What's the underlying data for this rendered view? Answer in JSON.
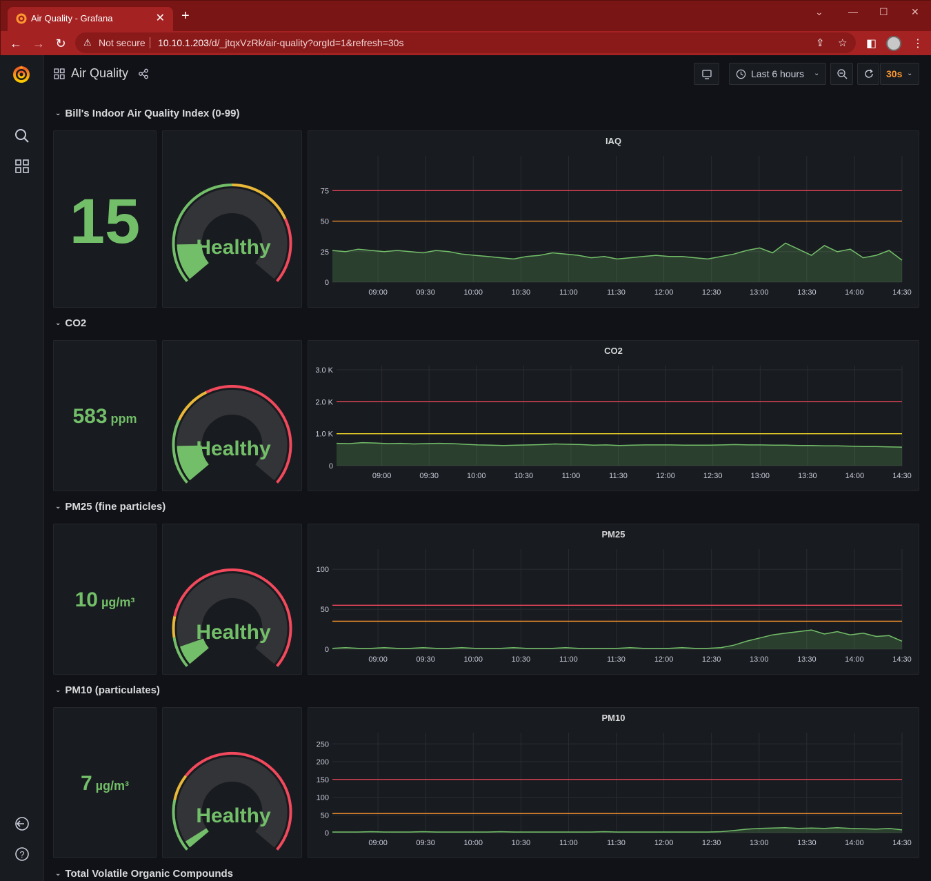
{
  "browser": {
    "tab_title": "Air Quality - Grafana",
    "security_label": "Not secure",
    "url_host": "10.10.1.203",
    "url_path": "/d/_jtqxVzRk/air-quality?orgId=1&refresh=30s"
  },
  "dashboard": {
    "title": "Air Quality",
    "time_range_label": "Last 6 hours",
    "refresh_label": "30s"
  },
  "colors": {
    "green": "#73bf69",
    "red": "#f2495c",
    "orange": "#ff9830",
    "yellow": "#fade2a",
    "refresh_accent": "#ff9830"
  },
  "rows": [
    {
      "title": "Bill's Indoor Air Quality Index (0-99)",
      "stat_value": "15",
      "stat_unit": "",
      "gauge_label": "Healthy",
      "gauge_fraction": 0.15,
      "gauge_thresholds": [
        {
          "from": 0,
          "to": 0.5,
          "color": "#73bf69"
        },
        {
          "from": 0.5,
          "to": 0.75,
          "color": "#eab839"
        },
        {
          "from": 0.75,
          "to": 1.0,
          "color": "#f2495c"
        }
      ],
      "chart_title": "IAQ"
    },
    {
      "title": "CO2",
      "stat_value": "583",
      "stat_unit": "ppm",
      "gauge_label": "Healthy",
      "gauge_fraction": 0.15,
      "gauge_thresholds": [
        {
          "from": 0,
          "to": 0.25,
          "color": "#73bf69"
        },
        {
          "from": 0.25,
          "to": 0.4,
          "color": "#eab839"
        },
        {
          "from": 0.4,
          "to": 1.0,
          "color": "#f2495c"
        }
      ],
      "chart_title": "CO2"
    },
    {
      "title": "PM25 (fine particles)",
      "stat_value": "10",
      "stat_unit": "µg/m³",
      "gauge_label": "Healthy",
      "gauge_fraction": 0.08,
      "gauge_thresholds": [
        {
          "from": 0,
          "to": 0.12,
          "color": "#73bf69"
        },
        {
          "from": 0.12,
          "to": 0.2,
          "color": "#eab839"
        },
        {
          "from": 0.2,
          "to": 1.0,
          "color": "#f2495c"
        }
      ],
      "chart_title": "PM25"
    },
    {
      "title": "PM10 (particulates)",
      "stat_value": "7",
      "stat_unit": "µg/m³",
      "gauge_label": "Healthy",
      "gauge_fraction": 0.03,
      "gauge_thresholds": [
        {
          "from": 0,
          "to": 0.2,
          "color": "#73bf69"
        },
        {
          "from": 0.2,
          "to": 0.3,
          "color": "#eab839"
        },
        {
          "from": 0.3,
          "to": 1.0,
          "color": "#f2495c"
        }
      ],
      "chart_title": "PM10"
    },
    {
      "title": "Total Volatile Organic Compounds"
    }
  ],
  "chart_data": [
    {
      "type": "area",
      "title": "IAQ",
      "x_ticks": [
        "09:00",
        "09:30",
        "10:00",
        "10:30",
        "11:00",
        "11:30",
        "12:00",
        "12:30",
        "13:00",
        "13:30",
        "14:00",
        "14:30"
      ],
      "y_ticks": [
        "0",
        "25",
        "50",
        "75"
      ],
      "ylim": [
        0,
        100
      ],
      "threshold_lines": [
        {
          "value": 75,
          "color": "#f2495c"
        },
        {
          "value": 50,
          "color": "#ff9830"
        }
      ],
      "series": [
        {
          "values": [
            26,
            25,
            27,
            26,
            25,
            26,
            25,
            24,
            26,
            25,
            23,
            22,
            21,
            20,
            19,
            21,
            22,
            24,
            23,
            22,
            20,
            21,
            19,
            20,
            21,
            22,
            21,
            21,
            20,
            19,
            21,
            23,
            26,
            28,
            24,
            32,
            27,
            22,
            30,
            25,
            27,
            20,
            22,
            26,
            18
          ]
        }
      ]
    },
    {
      "type": "area",
      "title": "CO2",
      "x_ticks": [
        "09:00",
        "09:30",
        "10:00",
        "10:30",
        "11:00",
        "11:30",
        "12:00",
        "12:30",
        "13:00",
        "13:30",
        "14:00",
        "14:30"
      ],
      "y_ticks": [
        "0",
        "1.0 K",
        "2.0 K",
        "3.0 K"
      ],
      "ylim": [
        0,
        3000
      ],
      "threshold_lines": [
        {
          "value": 2000,
          "color": "#f2495c"
        },
        {
          "value": 1000,
          "color": "#fade2a"
        }
      ],
      "series": [
        {
          "values": [
            700,
            690,
            720,
            710,
            690,
            700,
            680,
            690,
            700,
            690,
            670,
            650,
            640,
            630,
            640,
            650,
            660,
            680,
            670,
            660,
            640,
            650,
            630,
            640,
            650,
            650,
            650,
            640,
            640,
            640,
            650,
            660,
            650,
            650,
            640,
            640,
            630,
            630,
            620,
            620,
            610,
            600,
            600,
            590,
            580
          ]
        }
      ]
    },
    {
      "type": "area",
      "title": "PM25",
      "x_ticks": [
        "09:00",
        "09:30",
        "10:00",
        "10:30",
        "11:00",
        "11:30",
        "12:00",
        "12:30",
        "13:00",
        "13:30",
        "14:00",
        "14:30"
      ],
      "y_ticks": [
        "0",
        "50",
        "100"
      ],
      "ylim": [
        0,
        120
      ],
      "threshold_lines": [
        {
          "value": 55,
          "color": "#f2495c"
        },
        {
          "value": 35,
          "color": "#ff9830"
        }
      ],
      "series": [
        {
          "values": [
            1,
            2,
            1,
            1,
            2,
            1,
            1,
            2,
            1,
            1,
            2,
            1,
            1,
            1,
            2,
            1,
            1,
            1,
            2,
            1,
            1,
            1,
            1,
            2,
            1,
            1,
            1,
            2,
            1,
            1,
            2,
            5,
            10,
            14,
            18,
            20,
            22,
            24,
            19,
            22,
            18,
            20,
            16,
            17,
            10
          ]
        }
      ]
    },
    {
      "type": "area",
      "title": "PM10",
      "x_ticks": [
        "09:00",
        "09:30",
        "10:00",
        "10:30",
        "11:00",
        "11:30",
        "12:00",
        "12:30",
        "13:00",
        "13:30",
        "14:00",
        "14:30"
      ],
      "y_ticks": [
        "0",
        "50",
        "100",
        "150",
        "200",
        "250"
      ],
      "ylim": [
        0,
        270
      ],
      "threshold_lines": [
        {
          "value": 150,
          "color": "#f2495c"
        },
        {
          "value": 54,
          "color": "#ff9830"
        }
      ],
      "series": [
        {
          "values": [
            2,
            2,
            2,
            3,
            2,
            2,
            2,
            3,
            2,
            2,
            2,
            2,
            2,
            3,
            2,
            2,
            2,
            2,
            2,
            2,
            2,
            3,
            2,
            2,
            2,
            2,
            2,
            2,
            2,
            2,
            3,
            6,
            10,
            12,
            13,
            14,
            12,
            13,
            12,
            14,
            12,
            11,
            10,
            12,
            8
          ]
        }
      ]
    }
  ]
}
